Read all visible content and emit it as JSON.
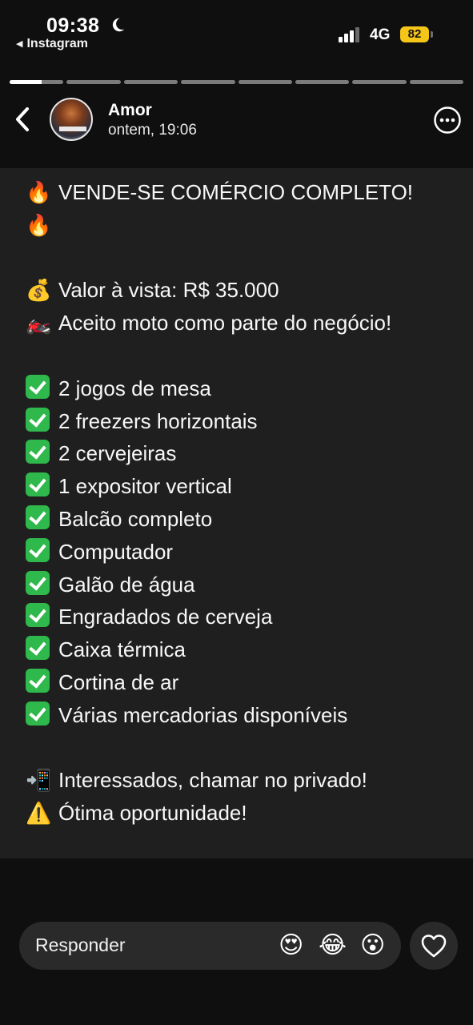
{
  "status_bar": {
    "time": "09:38",
    "back_app": "Instagram",
    "network": "4G",
    "battery": "82"
  },
  "story": {
    "segments_total": 8,
    "current_segment": 1,
    "current_segment_progress": 0.6,
    "user": "Amor",
    "timestamp": "ontem, 19:06",
    "lines": [
      {
        "icon": "🔥",
        "text": "VENDE-SE COMÉRCIO COMPLETO!"
      },
      {
        "icon": "🔥",
        "text": ""
      },
      {
        "icon": "",
        "text": ""
      },
      {
        "icon": "💰",
        "text": "Valor à vista: R$ 35.000"
      },
      {
        "icon": "🏍️",
        "text": "Aceito moto como parte do negócio!"
      },
      {
        "icon": "",
        "text": ""
      },
      {
        "icon": "✅",
        "text": "2 jogos de mesa"
      },
      {
        "icon": "✅",
        "text": "2 freezers horizontais"
      },
      {
        "icon": "✅",
        "text": "2 cervejeiras"
      },
      {
        "icon": "✅",
        "text": "1 expositor vertical"
      },
      {
        "icon": "✅",
        "text": "Balcão completo"
      },
      {
        "icon": "✅",
        "text": "Computador"
      },
      {
        "icon": "✅",
        "text": "Galão de água"
      },
      {
        "icon": "✅",
        "text": "Engradados de cerveja"
      },
      {
        "icon": "✅",
        "text": "Caixa térmica"
      },
      {
        "icon": "✅",
        "text": "Cortina de ar"
      },
      {
        "icon": "✅",
        "text": "Várias mercadorias disponíveis"
      },
      {
        "icon": "",
        "text": ""
      },
      {
        "icon": "📲",
        "text": "Interessados, chamar no privado!"
      },
      {
        "icon": "⚠️",
        "text": "Ótima oportunidade!"
      }
    ]
  },
  "reply": {
    "placeholder": "Responder",
    "reactions": [
      "😍",
      "😂",
      "😮"
    ]
  }
}
